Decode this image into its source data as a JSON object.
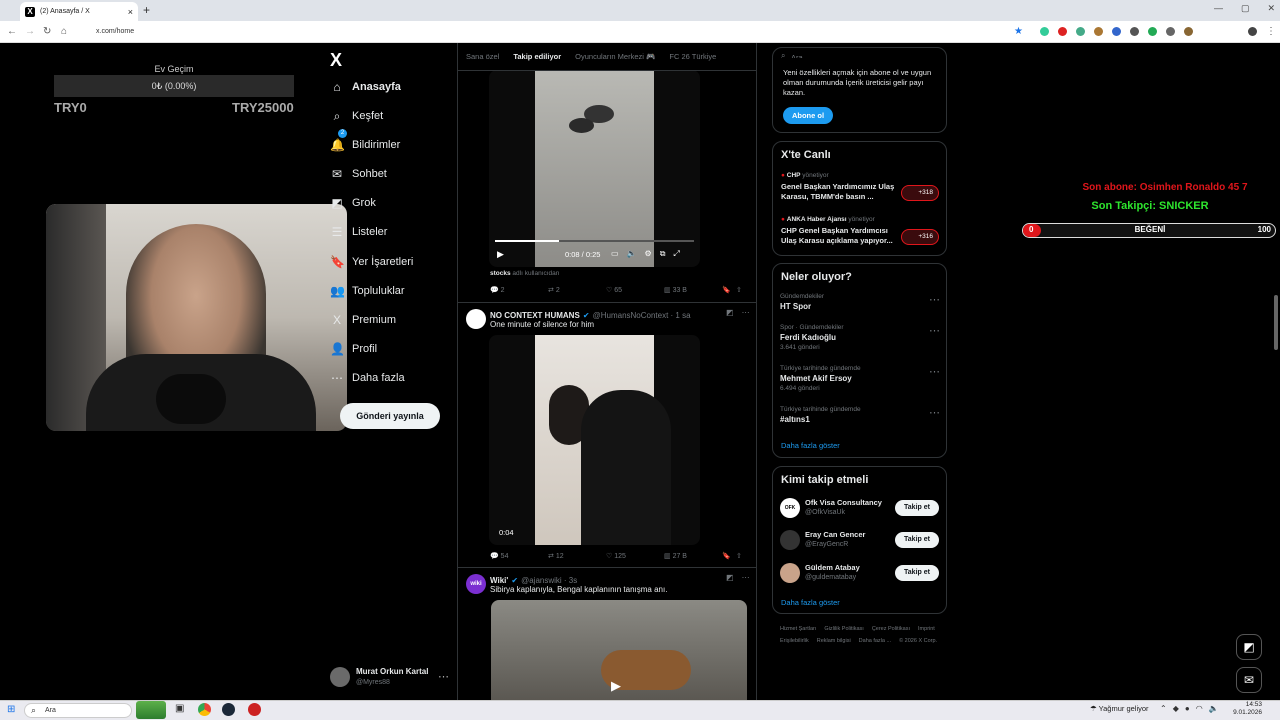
{
  "browser": {
    "tab_title": "(2) Anasayfa / X",
    "url": "x.com/home"
  },
  "overlay": {
    "goal_title": "Ev Geçim",
    "goal_progress": "0₺ (0.00%)",
    "goal_min": "TRY0",
    "goal_max": "TRY25000",
    "last_sub": "Son abone: Osimhen Ronaldo 45 7",
    "last_follower": "Son Takipçi: SNICKER",
    "likes_current": "0",
    "likes_label": "BEĞENİ",
    "likes_target": "100",
    "colors": {
      "sub": "#e0161b",
      "follower": "#2ee62e",
      "likes_fill": "#e0161b"
    }
  },
  "nav": {
    "logo": "X",
    "items": [
      {
        "label": "Anasayfa",
        "icon": "home-icon",
        "glyph": "⌂"
      },
      {
        "label": "Keşfet",
        "icon": "search-icon",
        "glyph": "⌕"
      },
      {
        "label": "Bildirimler",
        "icon": "bell-icon",
        "glyph": "🔔",
        "badge": "2"
      },
      {
        "label": "Sohbet",
        "icon": "mail-icon",
        "glyph": "✉"
      },
      {
        "label": "Grok",
        "icon": "grok-icon",
        "glyph": "◩"
      },
      {
        "label": "Listeler",
        "icon": "list-icon",
        "glyph": "☰"
      },
      {
        "label": "Yer İşaretleri",
        "icon": "bookmark-icon",
        "glyph": "🔖"
      },
      {
        "label": "Topluluklar",
        "icon": "communities-icon",
        "glyph": "👥"
      },
      {
        "label": "Premium",
        "icon": "premium-icon",
        "glyph": "X"
      },
      {
        "label": "Profil",
        "icon": "profile-icon",
        "glyph": "👤"
      },
      {
        "label": "Daha fazla",
        "icon": "more-icon",
        "glyph": "⋯"
      }
    ],
    "post_button": "Gönderi yayınla",
    "profile_name": "Murat Orkun Kartal",
    "profile_handle": "@Myres88"
  },
  "feed": {
    "tabs": [
      "Sana özel",
      "Takip ediliyor",
      "Oyuncuların Merkezi 🎮",
      "FC 26 Türkiye"
    ],
    "active_tab": "Takip ediliyor",
    "tweets": [
      {
        "media_time": "0:08 / 0:25",
        "video_progress": 0.32,
        "credit_user": "stocks",
        "credit_suffix": "adlı kullanıcıdan",
        "replies": "2",
        "reposts": "2",
        "likes": "65",
        "views": "33 B"
      },
      {
        "name": "NO CONTEXT HUMANS",
        "handle": "@HumansNoContext · 1 sa",
        "text": "One minute of silence for him",
        "media_time": "0:04",
        "replies": "54",
        "reposts": "12",
        "likes": "125",
        "views": "27 B"
      },
      {
        "name": "Wiki'",
        "handle": "@ajanswiki · 3s",
        "text": "Sibirya kaplanıyla, Bengal kaplanının tanışma anı."
      }
    ]
  },
  "right": {
    "search_placeholder": "Ara",
    "premium_text": "Yeni özellikleri açmak için abone ol ve uygun olman durumunda İçerik üreticisi gelir payı kazan.",
    "premium_button": "Abone ol",
    "live_title": "X'te Canlı",
    "live": [
      {
        "host": "CHP",
        "status": "yönetiyor",
        "title": "Genel Başkan Yardımcımız Ulaş Karasu, TBMM'de basın ...",
        "count": "+318"
      },
      {
        "host": "ANKA Haber Ajansı",
        "status": "yönetiyor",
        "title": "CHP Genel Başkan Yardımcısı Ulaş Karasu açıklama yapıyor...",
        "count": "+316"
      }
    ],
    "trends_title": "Neler oluyor?",
    "trends": [
      {
        "context": "Gündemdekiler",
        "name": "HT Spor",
        "count": ""
      },
      {
        "context": "Spor · Gündemdekiler",
        "name": "Ferdi Kadıoğlu",
        "count": "3.641 gönderi"
      },
      {
        "context": "Türkiye tarihinde gündemde",
        "name": "Mehmet Akif Ersoy",
        "count": "6.494 gönderi"
      },
      {
        "context": "Türkiye tarihinde gündemde",
        "name": "#altıns1",
        "count": ""
      }
    ],
    "show_more": "Daha fazla göster",
    "who_title": "Kimi takip etmeli",
    "who": [
      {
        "name": "Ofk Visa Consultancy",
        "handle": "@OfkVisaUk",
        "avatar": "OFK",
        "button": "Takip et"
      },
      {
        "name": "Eray Can Gencer",
        "handle": "@ErayGencR",
        "avatar": "",
        "button": "Takip et"
      },
      {
        "name": "Güldem Atabay",
        "handle": "@guldematabay",
        "avatar": "",
        "button": "Takip et"
      }
    ],
    "footer": [
      "Hizmet Şartları",
      "Gizlilik Politikası",
      "Çerez Politikası",
      "Imprint",
      "Erişilebilirlik",
      "Reklam bilgisi",
      "Daha fazla ...",
      "© 2026 X Corp."
    ]
  },
  "taskbar": {
    "search": "Ara",
    "weather": "Yağmur geliyor",
    "time": "14:53",
    "date": "9.01.2026"
  }
}
